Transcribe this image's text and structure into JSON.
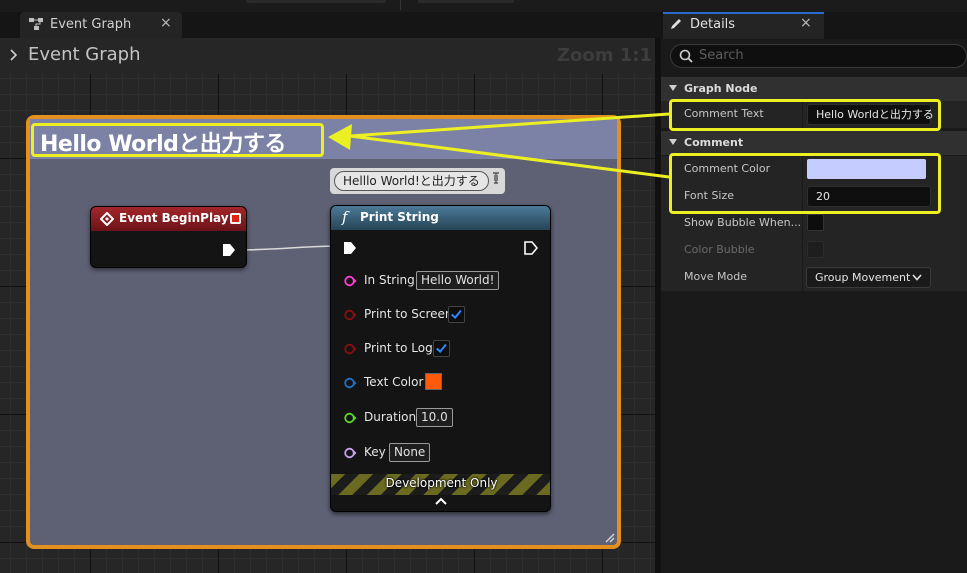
{
  "graph_tab": {
    "label": "Event Graph",
    "close": "×"
  },
  "graph_header": {
    "title": "Event Graph",
    "zoom": "Zoom 1:1"
  },
  "comment": {
    "title": "Hello Worldと出力する"
  },
  "bubble": {
    "text": "Helllo World!と出力する"
  },
  "event_node": {
    "title": "Event BeginPlay"
  },
  "print_node": {
    "title": "Print String",
    "function_glyph": "f",
    "pins": {
      "in_string": {
        "label": "In String",
        "value": "Hello World!"
      },
      "print_to_screen": {
        "label": "Print to Screen",
        "checked": true
      },
      "print_to_log": {
        "label": "Print to Log",
        "checked": true
      },
      "text_color": {
        "label": "Text Color",
        "color": "#ff5a0a"
      },
      "duration": {
        "label": "Duration",
        "value": "10.0"
      },
      "key": {
        "label": "Key",
        "value": "None"
      }
    },
    "footer": "Development Only"
  },
  "details": {
    "tab_label": "Details",
    "close": "×",
    "search_placeholder": "Search",
    "categories": {
      "graph_node": "Graph Node",
      "comment": "Comment"
    },
    "rows": {
      "comment_text": {
        "label": "Comment Text",
        "value": "Hello Worldと出力する"
      },
      "comment_color": {
        "label": "Comment Color",
        "color": "#c5ccff"
      },
      "font_size": {
        "label": "Font Size",
        "value": "20"
      },
      "show_bubble": {
        "label": "Show Bubble When..."
      },
      "color_bubble": {
        "label": "Color Bubble"
      },
      "move_mode": {
        "label": "Move Mode",
        "value": "Group Movement"
      }
    }
  },
  "colors": {
    "highlight": "#ecf022",
    "comment_border": "#e3901e",
    "comment_header": "#7b82a5",
    "event_header": "#a3262b",
    "function_header": "#4b7a98"
  }
}
